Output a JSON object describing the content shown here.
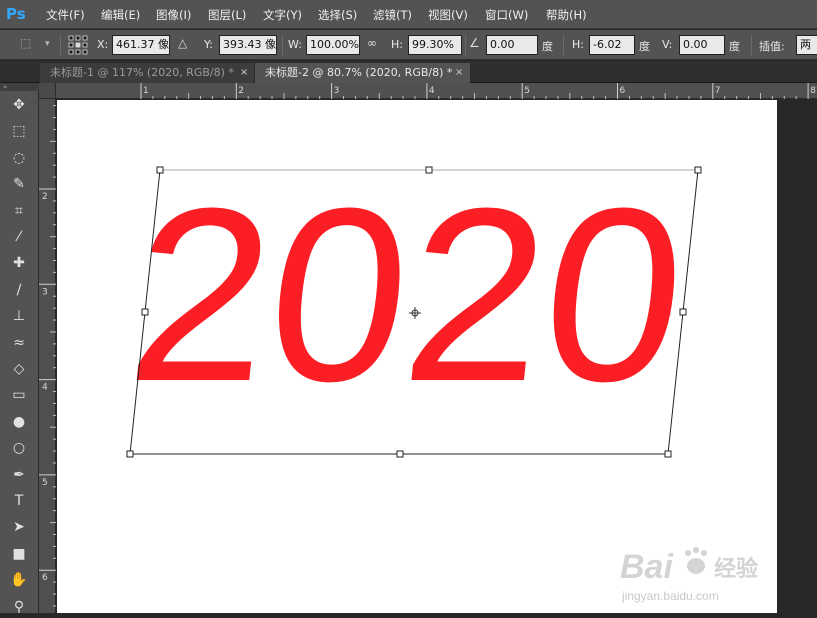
{
  "app": {
    "logo": "Ps"
  },
  "menu": [
    {
      "label": "文件(F)"
    },
    {
      "label": "编辑(E)"
    },
    {
      "label": "图像(I)"
    },
    {
      "label": "图层(L)"
    },
    {
      "label": "文字(Y)"
    },
    {
      "label": "选择(S)"
    },
    {
      "label": "滤镜(T)"
    },
    {
      "label": "视图(V)"
    },
    {
      "label": "窗口(W)"
    },
    {
      "label": "帮助(H)"
    }
  ],
  "options": {
    "x_label": "X:",
    "x_value": "461.37 像",
    "y_label": "Y:",
    "y_value": "393.43 像",
    "w_label": "W:",
    "w_value": "100.00%",
    "h_label": "H:",
    "h_value": "99.30%",
    "angle_value": "0.00",
    "angle_unit": "度",
    "hskew_label": "H:",
    "hskew_value": "-6.02",
    "hskew_unit": "度",
    "vskew_label": "V:",
    "vskew_value": "0.00",
    "vskew_unit": "度",
    "interp_label": "插值:",
    "interp_value": "两"
  },
  "tabs": [
    {
      "label": "未标题-1 @ 117% (2020, RGB/8) *",
      "active": false,
      "close": "×"
    },
    {
      "label": "未标题-2 @ 80.7% (2020, RGB/8) *",
      "active": true,
      "close": "×"
    }
  ],
  "toolbar": {
    "grip": "»",
    "tools": [
      {
        "name": "move-tool-icon",
        "glyph": "✥"
      },
      {
        "name": "marquee-tool-icon",
        "glyph": "⬚"
      },
      {
        "name": "lasso-tool-icon",
        "glyph": "◌"
      },
      {
        "name": "quick-select-tool-icon",
        "glyph": "✎"
      },
      {
        "name": "crop-tool-icon",
        "glyph": "⌗"
      },
      {
        "name": "eyedropper-tool-icon",
        "glyph": "⁄"
      },
      {
        "name": "healing-brush-tool-icon",
        "glyph": "✚"
      },
      {
        "name": "brush-tool-icon",
        "glyph": "∕"
      },
      {
        "name": "stamp-tool-icon",
        "glyph": "⊥"
      },
      {
        "name": "history-brush-tool-icon",
        "glyph": "≈"
      },
      {
        "name": "eraser-tool-icon",
        "glyph": "◇"
      },
      {
        "name": "gradient-tool-icon",
        "glyph": "▭"
      },
      {
        "name": "blur-tool-icon",
        "glyph": "●"
      },
      {
        "name": "dodge-tool-icon",
        "glyph": "○"
      },
      {
        "name": "pen-tool-icon",
        "glyph": "✒"
      },
      {
        "name": "type-tool-icon",
        "glyph": "T"
      },
      {
        "name": "path-select-tool-icon",
        "glyph": "➤"
      },
      {
        "name": "shape-tool-icon",
        "glyph": "■"
      },
      {
        "name": "hand-tool-icon",
        "glyph": "✋"
      },
      {
        "name": "zoom-tool-icon",
        "glyph": "⚲"
      }
    ]
  },
  "ruler_top": [
    "1",
    "2",
    "3",
    "4",
    "5",
    "6",
    "7",
    "8"
  ],
  "ruler_left": [
    "2",
    "3",
    "4",
    "5",
    "6"
  ],
  "canvas": {
    "text": "2020",
    "text_color": "#fb1f25"
  },
  "watermark": {
    "brand": "Bai",
    "brand_cn": "经验",
    "url": "jingyan.baidu.com"
  },
  "colors": {
    "ui_bg": "#535353",
    "canvas_bg": "#282828",
    "text_red": "#fb1f25",
    "ps_blue": "#31a8ff"
  }
}
